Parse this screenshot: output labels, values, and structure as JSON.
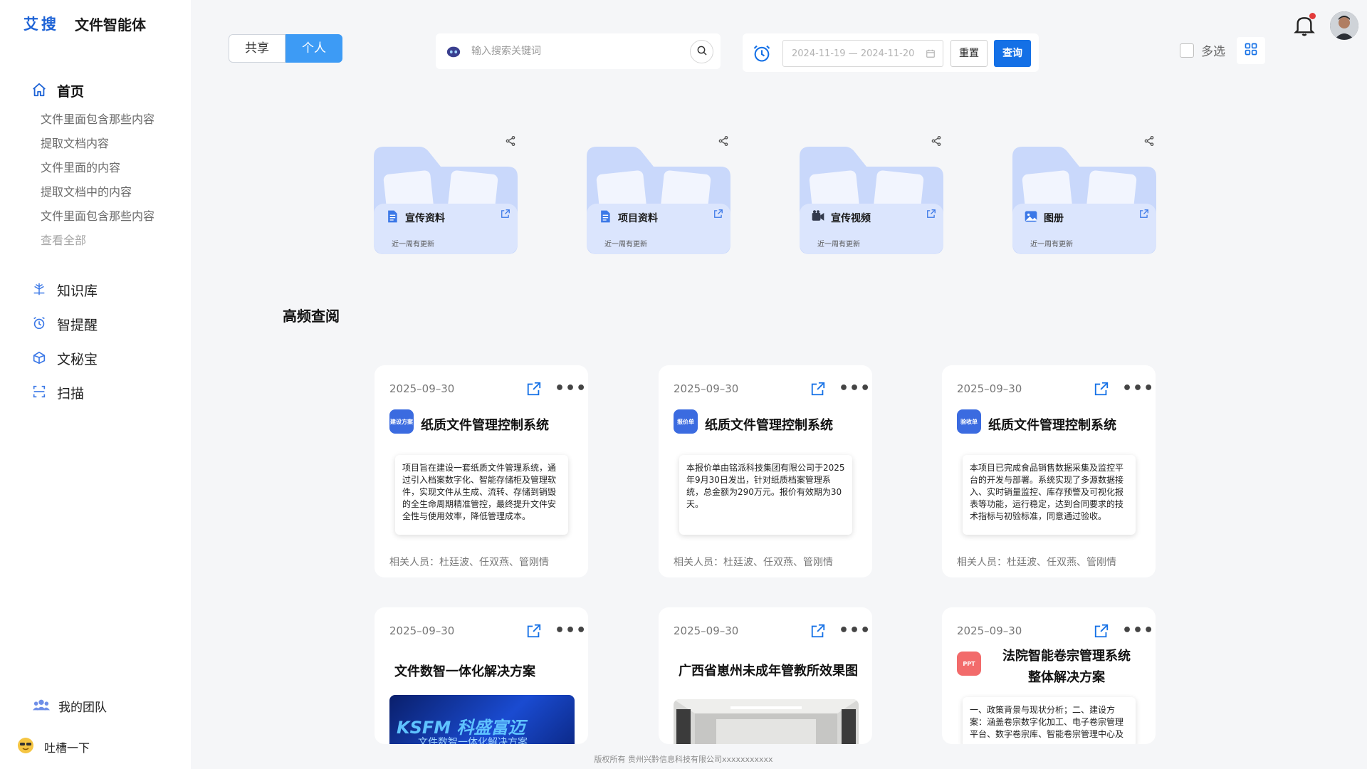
{
  "brand": {
    "logo": "艾搜",
    "name": "文件智能体"
  },
  "sidebar": {
    "home_label": "首页",
    "sub_items": [
      {
        "label": "文件里面包含那些内容"
      },
      {
        "label": "提取文档内容"
      },
      {
        "label": "文件里面的内容"
      },
      {
        "label": "提取文档中的内容"
      },
      {
        "label": "文件里面包含那些内容"
      }
    ],
    "view_all": "查看全部",
    "nav": [
      {
        "label": "知识库",
        "icon": "knowledge-icon"
      },
      {
        "label": "智提醒",
        "icon": "alarm-icon"
      },
      {
        "label": "文秘宝",
        "icon": "secretary-icon"
      },
      {
        "label": "扫描",
        "icon": "scan-icon"
      }
    ],
    "team_label": "我的团队",
    "feedback_label": "吐槽一下"
  },
  "topbar": {
    "segment": {
      "shared": "共享",
      "personal": "个人",
      "active": "personal"
    },
    "search": {
      "placeholder": "输入搜索关键词"
    },
    "date_range": "2024-11-19 — 2024-11-20",
    "reset_label": "重置",
    "query_label": "查询",
    "multi_select_label": "多选"
  },
  "folders": [
    {
      "name": "宣传资料",
      "updated": "近一周有更新",
      "icon": "document-icon"
    },
    {
      "name": "项目资料",
      "updated": "近一周有更新",
      "icon": "document-icon"
    },
    {
      "name": "宣传视频",
      "updated": "近一周有更新",
      "icon": "video-icon"
    },
    {
      "name": "图册",
      "updated": "近一周有更新",
      "icon": "image-icon"
    }
  ],
  "section_title": "高频查阅",
  "cards": [
    {
      "date": "2025–09–30",
      "badge": "建设方案",
      "title": "纸质文件管理控制系统",
      "summary": "项目旨在建设一套纸质文件管理系统，通过引入档案数字化、智能存储柜及管理软件，实现文件从生成、流转、存储到销毁的全生命周期精准管控，最终提升文件安全性与使用效率，降低管理成本。",
      "people": "相关人员：杜廷波、任双燕、管刚情"
    },
    {
      "date": "2025–09–30",
      "badge": "报价单",
      "title": "纸质文件管理控制系统",
      "summary": "本报价单由铭派科技集团有限公司于2025年9月30日发出，针对纸质档案管理系统，总金额为290万元。报价有效期为30天。",
      "people": "相关人员：杜廷波、任双燕、管刚情"
    },
    {
      "date": "2025–09–30",
      "badge": "验收单",
      "title": "纸质文件管理控制系统",
      "summary": "本项目已完成食品销售数据采集及监控平台的开发与部署。系统实现了多源数据接入、实时销量监控、库存预警及可视化报表等功能，运行稳定，达到合同要求的技术指标与初验标准，同意通过验收。",
      "people": "相关人员：杜廷波、任双燕、管刚情"
    },
    {
      "date": "2025–09–30",
      "title": "文件数智一体化解决方案",
      "thumb_text": "KSFM 科盛富迈",
      "thumb_sub": "文件数智一体化解决方案"
    },
    {
      "date": "2025–09–30",
      "title": "广西省崽州未成年管教所效果图"
    },
    {
      "date": "2025–09–30",
      "badge": "PPT",
      "title_line1": "法院智能卷宗管理系统",
      "title_line2": "整体解决方案",
      "summary": "一、政策背景与现状分析；二、建设方案：涵盖卷宗数字化加工、电子卷宗管理平台、数字卷宗库、智能卷宗管理中心及"
    }
  ],
  "footer": "版权所有  贵州兴黔信息科技有限公司xxxxxxxxxxx",
  "colors": {
    "accent": "#1470e6",
    "segment_active": "#3d9bf5",
    "folder": "#c9d8fb",
    "notify_dot": "#e23b3b"
  }
}
